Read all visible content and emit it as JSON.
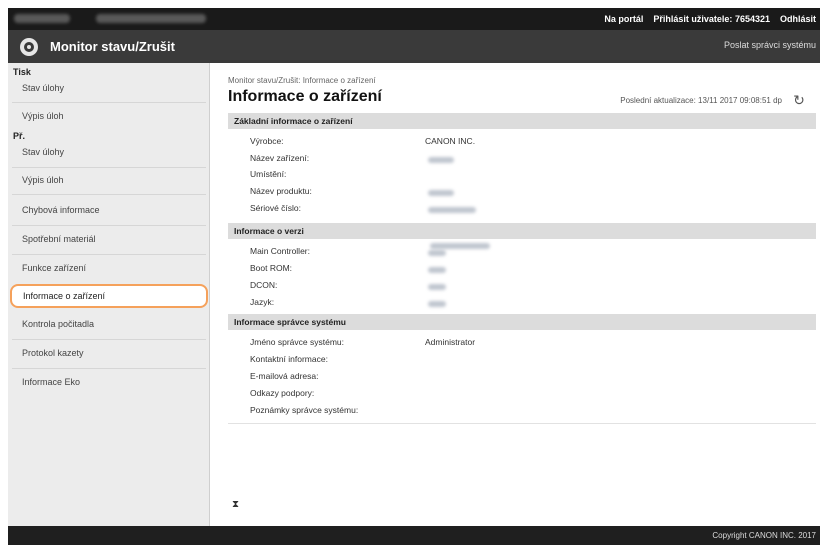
{
  "topbar": {
    "portal_label": "Na portál",
    "login_label": "Přihlásit uživatele:",
    "user_id": "7654321",
    "logout_label": "Odhlásit"
  },
  "header": {
    "title": "Monitor stavu/Zrušit",
    "admin_mail_link": "Poslat správci systému"
  },
  "sidebar": {
    "group_tisk": "Tisk",
    "tisk_items": [
      "Stav úlohy",
      "Výpis úloh"
    ],
    "group_prijem": "Př.",
    "prijem_items": [
      "Stav úlohy",
      "Výpis úloh"
    ],
    "other_items": [
      "Chybová informace",
      "Spotřební materiál",
      "Funkce zařízení",
      "Informace o zařízení",
      "Kontrola počitadla",
      "Protokol kazety",
      "Informace Eko"
    ]
  },
  "main": {
    "breadcrumb": "Monitor stavu/Zrušit: Informace o zařízení",
    "title": "Informace o zařízení",
    "last_update": "Poslední aktualizace: 13/11 2017 09:08:51 dp",
    "basic_section": {
      "heading": "Základní informace o zařízení",
      "manufacturer_label": "Výrobce:",
      "manufacturer_value": "CANON INC.",
      "device_name_label": "Název zařízení:",
      "location_label": "Umístění:",
      "product_name_label": "Název produktu:",
      "serial_label": "Sériové číslo:"
    },
    "version_section": {
      "heading": "Informace o verzi",
      "main_controller_label": "Main Controller:",
      "boot_rom_label": "Boot ROM:",
      "dcon_label": "DCON:",
      "language_label": "Jazyk:"
    },
    "admin_section": {
      "heading": "Informace správce systému",
      "admin_name_label": "Jméno správce systému:",
      "admin_name_value": "Administrator",
      "contact_label": "Kontaktní informace:",
      "email_label": "E-mailová adresa:",
      "support_label": "Odkazy podpory:",
      "notes_label": "Poznámky správce systému:"
    },
    "back_to_top": "⧗"
  },
  "footer": {
    "copyright": "Copyright CANON INC. 2017"
  }
}
